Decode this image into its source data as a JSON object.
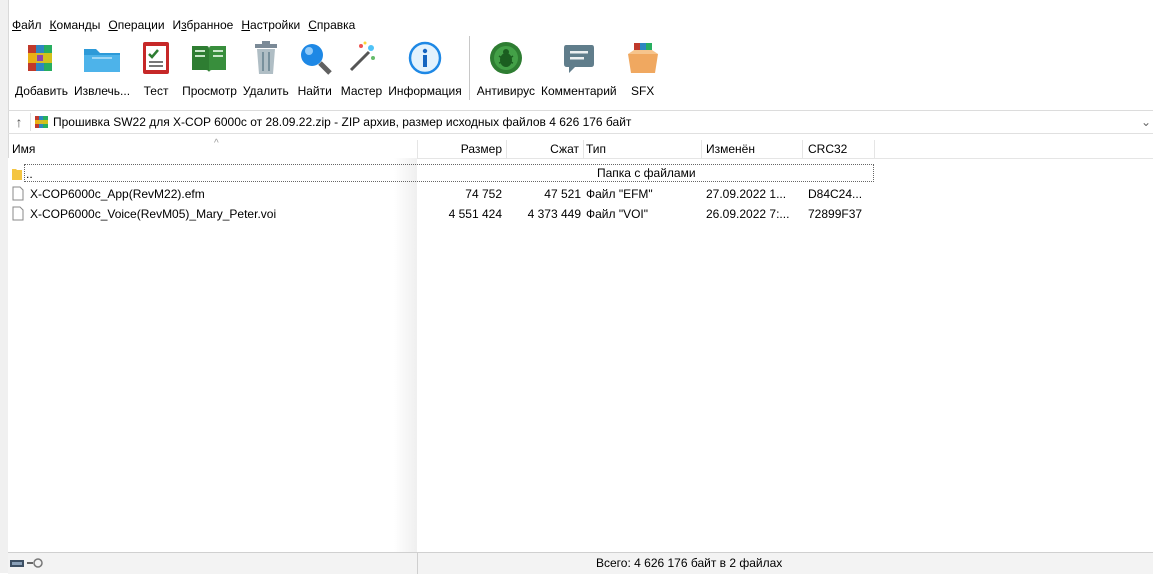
{
  "menu": {
    "items": [
      {
        "u": "Ф",
        "rest": "айл"
      },
      {
        "u": "К",
        "rest": "оманды"
      },
      {
        "u": "О",
        "rest": "перации"
      },
      {
        "pre": "И",
        "u": "з",
        "rest": "бранное"
      },
      {
        "u": "Н",
        "rest": "астройки"
      },
      {
        "u": "С",
        "rest": "правка"
      }
    ]
  },
  "toolbar": {
    "add": "Добавить",
    "extract": "Извлечь...",
    "test": "Тест",
    "view": "Просмотр",
    "delete": "Удалить",
    "find": "Найти",
    "wizard": "Мастер",
    "info": "Информация",
    "antivirus": "Антивирус",
    "comment": "Комментарий",
    "sfx": "SFX"
  },
  "address": {
    "text": "Прошивка SW22 для X-COP 6000c от 28.09.22.zip - ZIP архив, размер исходных файлов 4 626 176 байт"
  },
  "columns": {
    "name": "Имя",
    "size": "Размер",
    "packed": "Сжат",
    "type": "Тип",
    "modified": "Изменён",
    "crc": "CRC32"
  },
  "rows": [
    {
      "name": "..",
      "size": "",
      "packed": "",
      "type": "Папка с файлами",
      "modified": "",
      "crc": ""
    },
    {
      "name": "X-COP6000c_App(RevM22).efm",
      "size": "74 752",
      "packed": "47 521",
      "type": "Файл \"EFM\"",
      "modified": "27.09.2022 1...",
      "crc": "D84C24..."
    },
    {
      "name": "X-COP6000c_Voice(RevM05)_Mary_Peter.voi",
      "size": "4 551 424",
      "packed": "4 373 449",
      "type": "Файл \"VOI\"",
      "modified": "26.09.2022 7:...",
      "crc": "72899F37"
    }
  ],
  "status": {
    "summary": "Всего: 4 626 176 байт в 2 файлах"
  },
  "icons": {
    "up": "arrow-up-icon",
    "dropdown": "chevron-down-icon"
  }
}
